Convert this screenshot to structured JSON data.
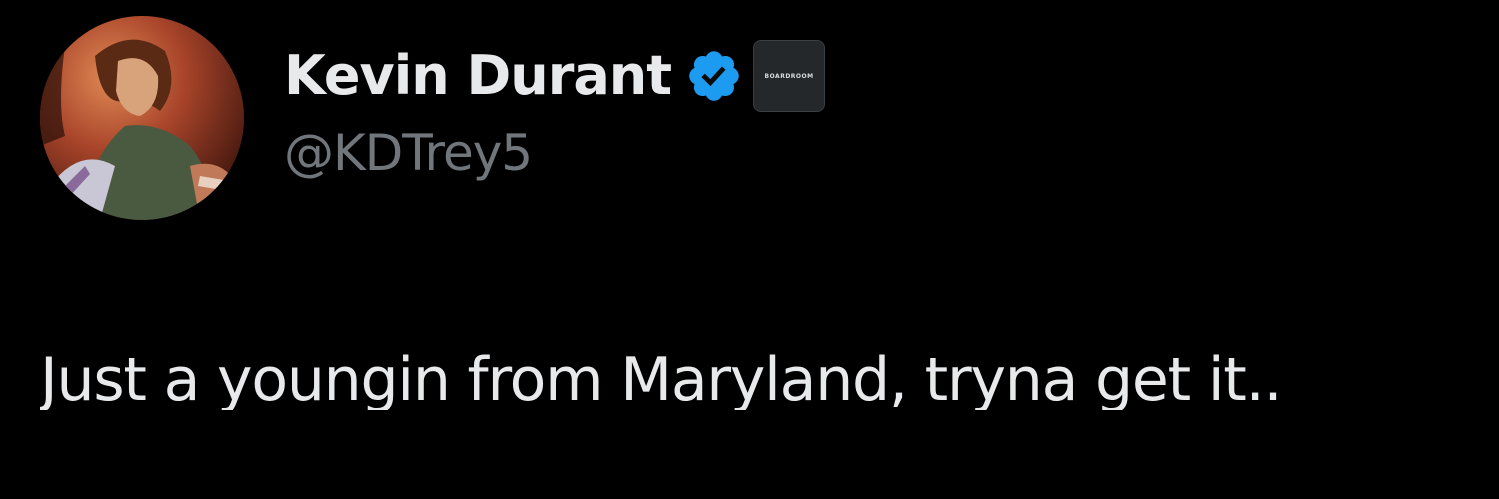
{
  "author": {
    "display_name": "Kevin Durant",
    "handle": "@KDTrey5",
    "verified_icon": "verified-check-icon",
    "affiliate_label": "BOARDROOM"
  },
  "tweet": {
    "text": "Just a youngin from Maryland, tryna get it.."
  },
  "colors": {
    "background": "#000000",
    "name": "#e7e9ea",
    "handle": "#71767b",
    "verified": "#1d9bf0"
  }
}
